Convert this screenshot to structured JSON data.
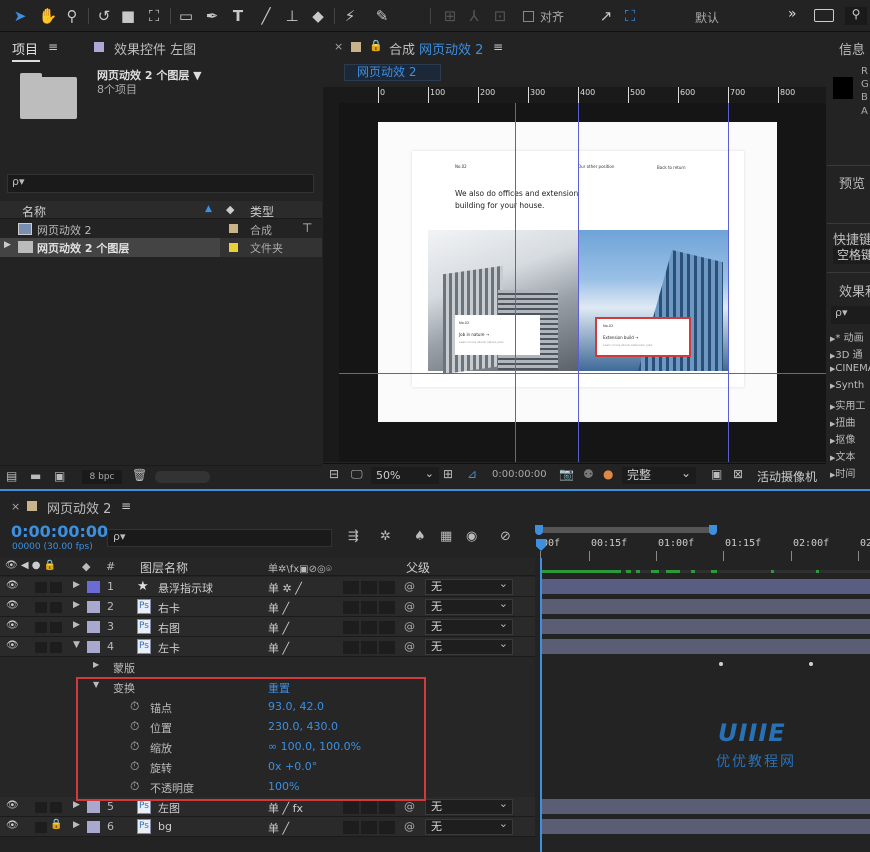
{
  "toolbar": {
    "tools": [
      "selection-tool",
      "hand-tool",
      "zoom-tool",
      "rotate-tool",
      "camera-tool",
      "pan-behind-tool",
      "rectangle-tool",
      "pen-tool",
      "type-tool",
      "brush-tool",
      "clone-stamp-tool",
      "eraser-tool",
      "roto-brush-tool",
      "puppet-pin-tool"
    ],
    "snap_label": "对齐",
    "workspace": "默认",
    "more": "»"
  },
  "project_panel": {
    "tab_project": "项目",
    "tab_effects": "效果控件 左图",
    "comp_name": "网页动效 2 个图层 ▼",
    "comp_info": "8个项目",
    "search_placeholder": "ρ▾",
    "col_name": "名称",
    "col_type": "类型",
    "items": [
      {
        "name": "网页动效 2",
        "type": "合成",
        "color": "#c9b48a"
      },
      {
        "name": "网页动效 2 个图层",
        "type": "文件夹",
        "color": "#e8d23a"
      }
    ],
    "bpc": "8 bpc"
  },
  "composition_panel": {
    "tab_label": "合成",
    "comp_title": "网页动效 2",
    "sub_tab": "网页动效 2",
    "ruler_marks": [
      "0",
      "100",
      "200",
      "300",
      "400",
      "500",
      "600",
      "700",
      "800"
    ],
    "zoom": "50%",
    "timecode": "0:00:00:00",
    "quality": "完整",
    "camera": "活动摄像机",
    "artboard": {
      "tag_left": "No.02",
      "nav_mid": "Our other position",
      "nav_right": "Back to return",
      "headline_line1": "We also do offices and extension",
      "headline_line2": "building for your house.",
      "card_left_num": "No.02",
      "card_left_title": "Job in nature →",
      "card_left_sub": "Learn more about nature jobs",
      "card_right_num": "No.02",
      "card_right_title": "Extension build →",
      "card_right_sub": "Learn more about extension jobs"
    }
  },
  "info_panel": {
    "title": "信息",
    "channels": [
      "R",
      "G",
      "B",
      "A"
    ],
    "preview_title": "预览",
    "shortcut_title": "快捷键",
    "shortcut_value": "空格键",
    "effects_title": "效果和",
    "search_placeholder": "ρ▾",
    "effect_groups": [
      "* 动画",
      "3D 通",
      "CINEMA",
      "Synth",
      "实用工",
      "扭曲",
      "抠像",
      "文本",
      "时间"
    ]
  },
  "timeline": {
    "tab_label": "网页动效 2",
    "timecode": "0:00:00:00",
    "fps_info": "00000 (30.00 fps)",
    "search_placeholder": "ρ▾",
    "col_layer_name": "图层名称",
    "col_switches": "单✲\\fx▣⊘◎⌾",
    "col_parent": "父级",
    "time_marks": [
      "00f",
      "00:15f",
      "01:00f",
      "01:15f",
      "02:00f",
      "02"
    ],
    "layers": [
      {
        "num": "1",
        "name": "悬浮指示球",
        "icon": "star",
        "color": "#6b6bd6",
        "switch": "单 ✲ ╱",
        "parent": "无"
      },
      {
        "num": "2",
        "name": "右卡",
        "icon": "img",
        "color": "#a9a9d0",
        "switch": "单   ╱",
        "parent": "无"
      },
      {
        "num": "3",
        "name": "右图",
        "icon": "img",
        "color": "#a9a9d0",
        "switch": "单   ╱",
        "parent": "无"
      },
      {
        "num": "4",
        "name": "左卡",
        "icon": "img",
        "color": "#a9a9d0",
        "switch": "单   ╱",
        "parent": "无"
      }
    ],
    "layer4_children": {
      "mask": "蒙版",
      "transform": "变换",
      "reset": "重置",
      "props": [
        {
          "name": "锚点",
          "value": "93.0, 42.0"
        },
        {
          "name": "位置",
          "value": "230.0, 430.0"
        },
        {
          "name": "缩放",
          "value": "∞ 100.0, 100.0%"
        },
        {
          "name": "旋转",
          "value": "0x +0.0°"
        },
        {
          "name": "不透明度",
          "value": "100%"
        }
      ]
    },
    "layers_after": [
      {
        "num": "5",
        "name": "左图",
        "icon": "img",
        "color": "#a9a9d0",
        "switch": "单  ╱ fx",
        "parent": "无"
      },
      {
        "num": "6",
        "name": "bg",
        "icon": "img",
        "color": "#a9a9d0",
        "switch": "单   ╱",
        "parent": "无"
      }
    ]
  },
  "watermark": {
    "logo": "UIIIE",
    "text": "优优教程网"
  },
  "colors": {
    "accent_blue": "#3d8fe0",
    "highlight_red": "#d03a3a",
    "guide_blue": "#5b5fd0"
  }
}
